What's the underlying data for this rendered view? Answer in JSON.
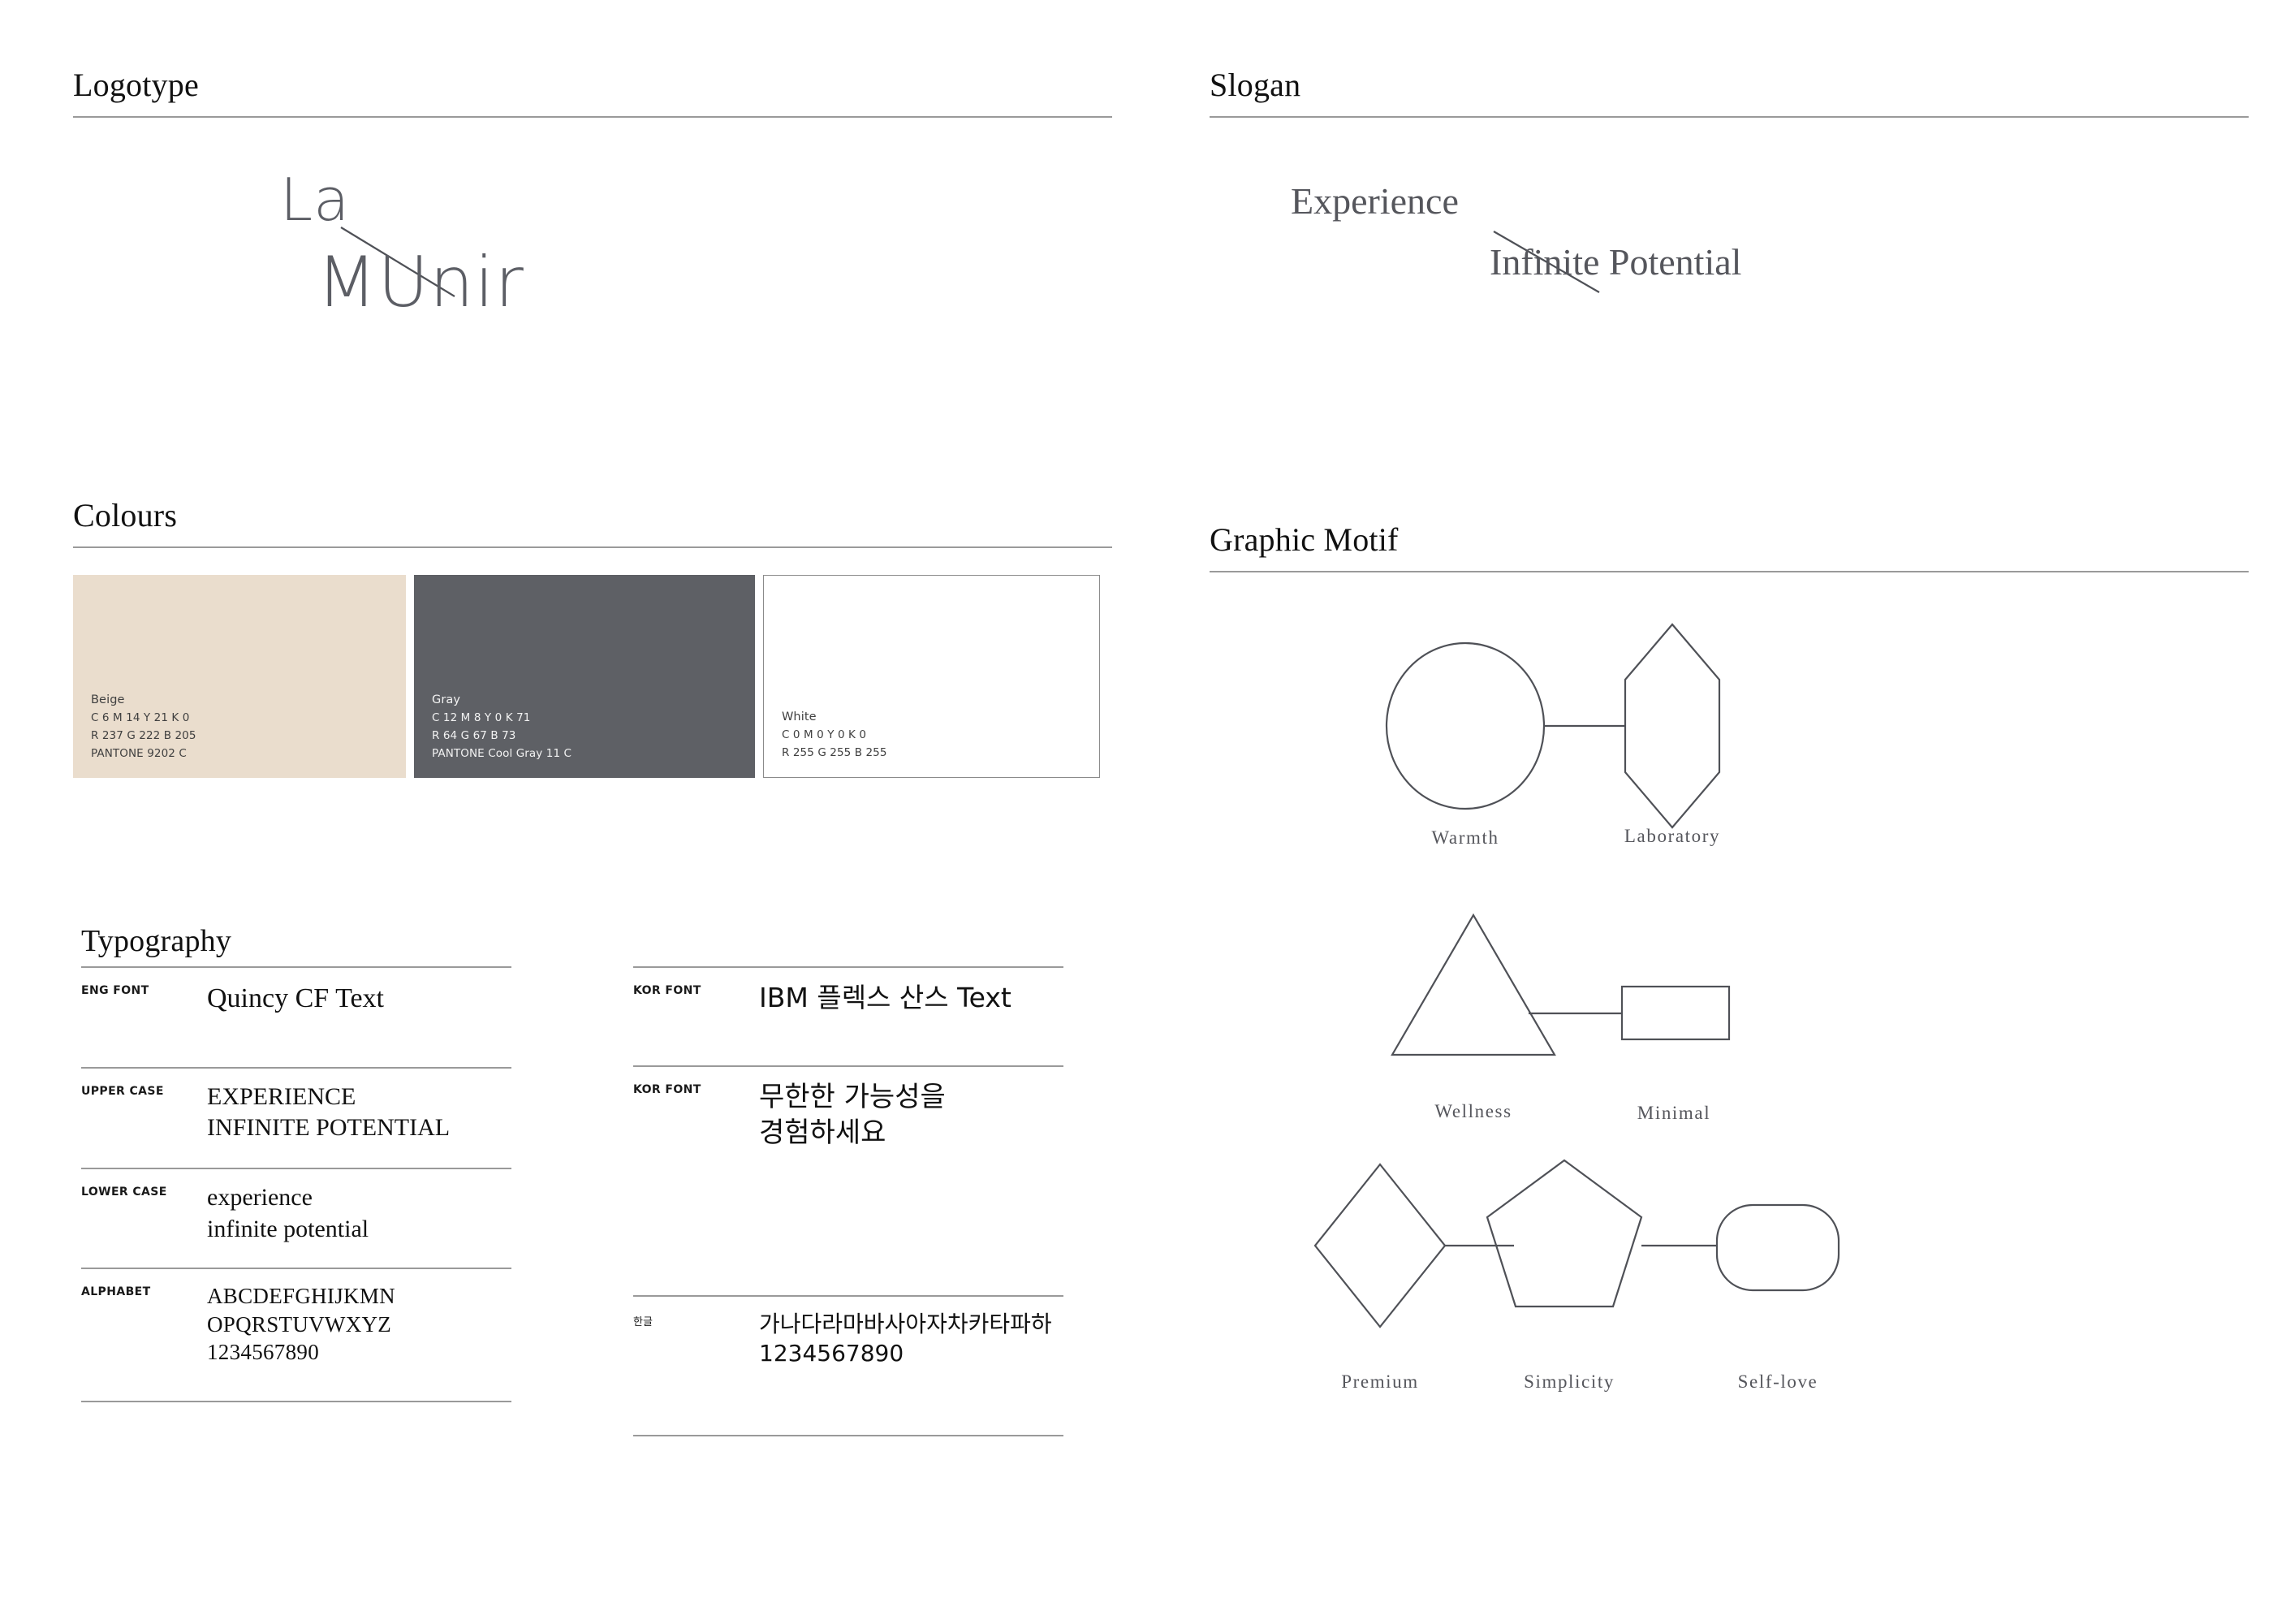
{
  "sections": {
    "logotype": {
      "title": "Logotype"
    },
    "slogan": {
      "title": "Slogan"
    },
    "colours": {
      "title": "Colours"
    },
    "typography": {
      "title": "Typography"
    },
    "motif": {
      "title": "Graphic Motif"
    }
  },
  "logotype": {
    "word_top": "La",
    "word_bottom": "MUnir",
    "color": "#5c5e65"
  },
  "slogan": {
    "line1": "Experience",
    "line2": "Infinite Potential",
    "color": "#55565c"
  },
  "colours": {
    "swatches": [
      {
        "name": "Beige",
        "cmyk": "C 6 M 14 Y 21 K 0",
        "rgb": "R 237 G 222 B 205",
        "pantone": "PANTONE 9202 C",
        "hex": "#eaddcd"
      },
      {
        "name": "Gray",
        "cmyk": "C 12 M 8 Y 0 K 71",
        "rgb": "R 64 G 67 B 73",
        "pantone": "PANTONE Cool Gray 11 C",
        "hex": "#5e6065"
      },
      {
        "name": "White",
        "cmyk": "C 0 M 0 Y 0 K 0",
        "rgb": "R 255 G 255 B 255",
        "pantone": "",
        "hex": "#ffffff"
      }
    ]
  },
  "typography": {
    "eng": [
      {
        "label": "ENG FONT",
        "lines": [
          "Quincy CF Text"
        ]
      },
      {
        "label": "UPPER CASE",
        "lines": [
          "EXPERIENCE",
          "INFINITE POTENTIAL"
        ]
      },
      {
        "label": "LOWER CASE",
        "lines": [
          "experience",
          "infinite potential"
        ]
      },
      {
        "label": "ALPHABET",
        "lines": [
          "ABCDEFGHIJKMN",
          "OPQRSTUVWXYZ",
          "1234567890"
        ]
      }
    ],
    "kor": [
      {
        "label": "KOR FONT",
        "lines": [
          "IBM 플렉스 산스 Text"
        ]
      },
      {
        "label": "KOR FONT",
        "lines": [
          "무한한 가능성을",
          "경험하세요"
        ]
      },
      {
        "label": "한글",
        "lines": [
          "가나다라마바사아자차카타파하",
          "1234567890"
        ]
      }
    ]
  },
  "motif": {
    "shapes": [
      {
        "label": "Warmth",
        "icon": "circle-shape"
      },
      {
        "label": "Laboratory",
        "icon": "hexagon-shape"
      },
      {
        "label": "Wellness",
        "icon": "triangle-shape"
      },
      {
        "label": "Minimal",
        "icon": "rectangle-shape"
      },
      {
        "label": "Premium",
        "icon": "diamond-shape"
      },
      {
        "label": "Simplicity",
        "icon": "pentagon-shape"
      },
      {
        "label": "Self-love",
        "icon": "rounded-rectangle-shape"
      }
    ],
    "stroke_color": "#4f5157"
  }
}
